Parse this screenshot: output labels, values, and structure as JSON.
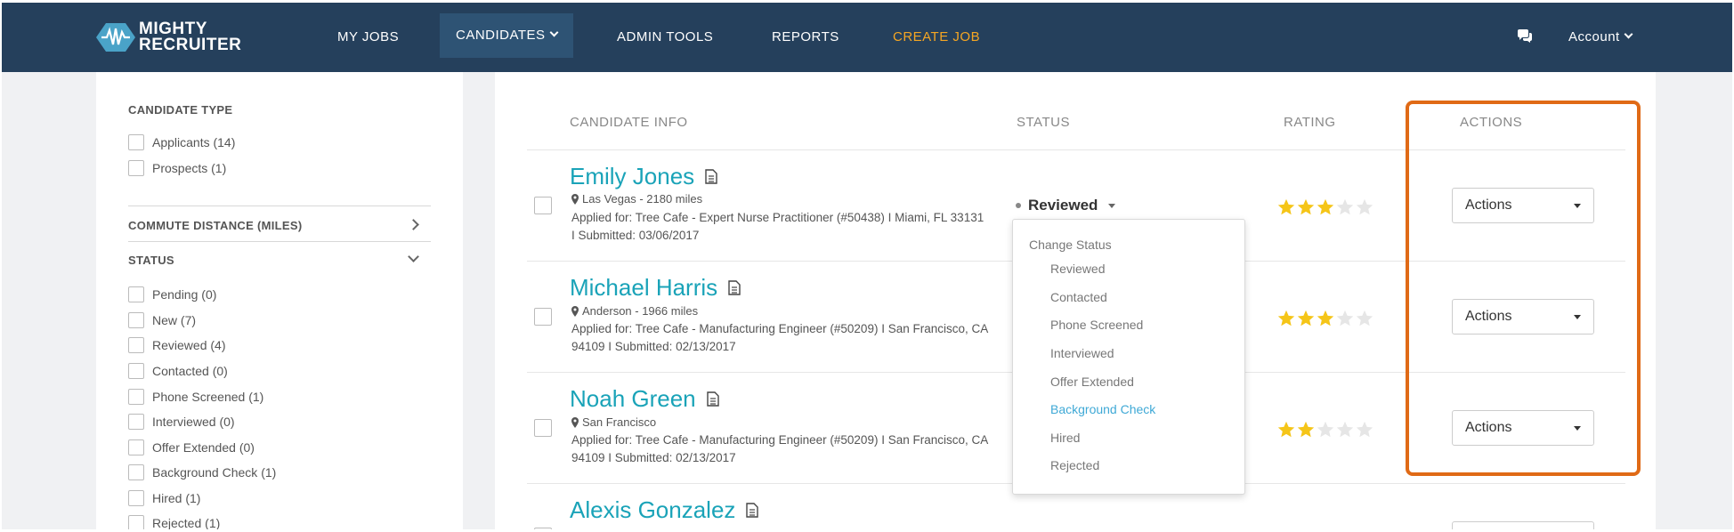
{
  "nav": {
    "logo_line1": "MIGHTY",
    "logo_line2": "RECRUITER",
    "items": [
      {
        "label": "MY JOBS"
      },
      {
        "label": "CANDIDATES"
      },
      {
        "label": "ADMIN TOOLS"
      },
      {
        "label": "REPORTS"
      },
      {
        "label": "CREATE JOB"
      }
    ],
    "account_label": "Account",
    "chat_icon": "chat-bubbles-icon"
  },
  "sidebar": {
    "candidate_type_heading": "CANDIDATE TYPE",
    "candidate_types": [
      {
        "label": "Applicants",
        "count": "(14)"
      },
      {
        "label": "Prospects",
        "count": "(1)"
      }
    ],
    "commute_heading": "COMMUTE DISTANCE (MILES)",
    "status_heading": "STATUS",
    "statuses": [
      {
        "label": "Pending",
        "count": "(0)"
      },
      {
        "label": "New",
        "count": "(7)"
      },
      {
        "label": "Reviewed",
        "count": "(4)"
      },
      {
        "label": "Contacted",
        "count": "(0)"
      },
      {
        "label": "Phone Screened",
        "count": "(1)"
      },
      {
        "label": "Interviewed",
        "count": "(0)"
      },
      {
        "label": "Offer Extended",
        "count": "(0)"
      },
      {
        "label": "Background Check",
        "count": "(1)"
      },
      {
        "label": "Hired",
        "count": "(1)"
      },
      {
        "label": "Rejected",
        "count": "(1)"
      }
    ]
  },
  "table": {
    "headers": {
      "candidate_info": "CANDIDATE INFO",
      "status": "STATUS",
      "rating": "RATING",
      "actions": "ACTIONS"
    },
    "rows": [
      {
        "name": "Emily Jones",
        "location": "Las Vegas - 2180 miles",
        "detail": "Applied for: Tree Cafe - Expert Nurse Practitioner (#50438)  I  Miami, FL 33131  I  Submitted: 03/06/2017",
        "rating": 3,
        "actions_label": "Actions"
      },
      {
        "name": "Michael Harris",
        "location": "Anderson - 1966 miles",
        "detail": "Applied for: Tree Cafe - Manufacturing Engineer (#50209)  I  San Francisco, CA 94109  I  Submitted: 02/13/2017",
        "rating": 3,
        "actions_label": "Actions"
      },
      {
        "name": "Noah Green",
        "location": "San Francisco",
        "detail": "Applied for: Tree Cafe - Manufacturing Engineer (#50209)  I  San Francisco, CA 94109  I  Submitted: 02/13/2017",
        "rating": 2,
        "actions_label": "Actions"
      },
      {
        "name": "Alexis Gonzalez"
      }
    ],
    "status_value": "Reviewed",
    "rating_max": 5
  },
  "status_menu": {
    "heading": "Change Status",
    "items": [
      {
        "label": "Reviewed"
      },
      {
        "label": "Contacted"
      },
      {
        "label": "Phone Screened"
      },
      {
        "label": "Interviewed"
      },
      {
        "label": "Offer Extended"
      },
      {
        "label": "Background Check"
      },
      {
        "label": "Hired"
      },
      {
        "label": "Rejected"
      }
    ],
    "highlighted": "Background Check"
  },
  "colors": {
    "nav_bg": "#25405c",
    "accent_teal": "#1aa3b8",
    "create_job": "#f5a623",
    "highlight_box": "#e06a16",
    "star_on": "#f5c518",
    "star_off": "#e6e6e6"
  }
}
